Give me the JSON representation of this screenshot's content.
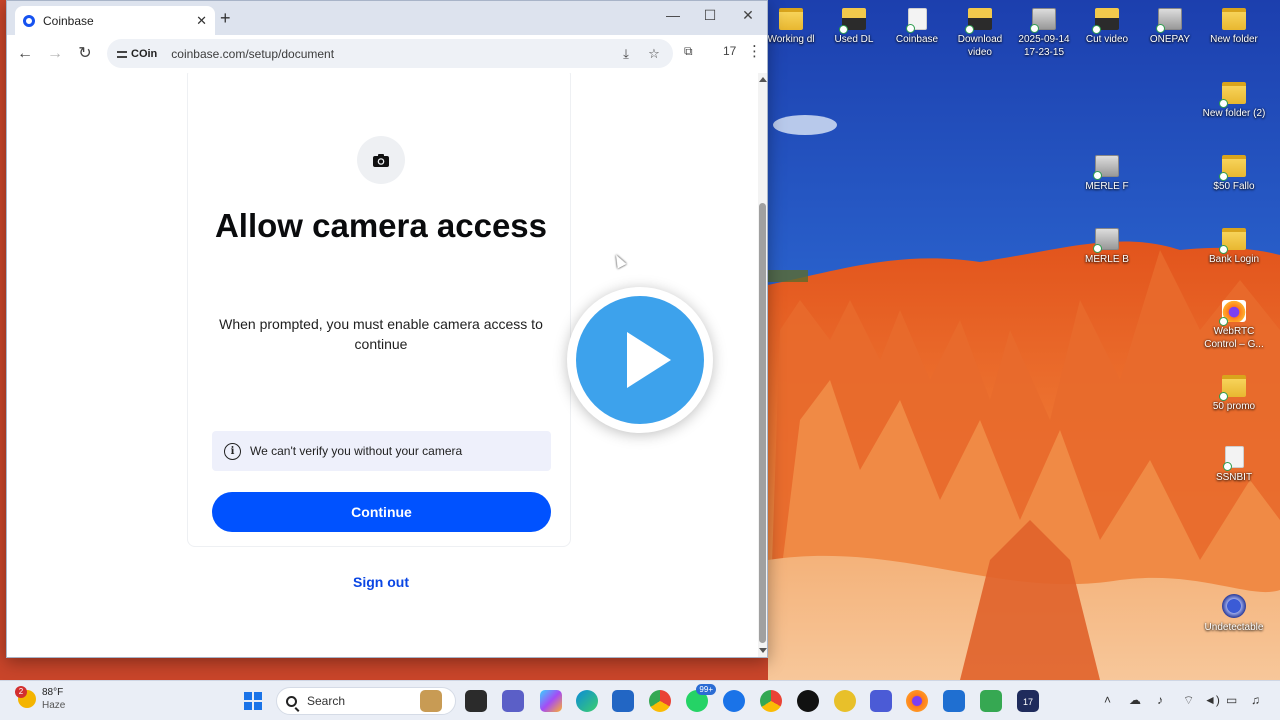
{
  "browser": {
    "tab_title": "Coinbase",
    "tab_close": "✕",
    "new_tab": "+",
    "window_controls": {
      "minimize": "—",
      "maximize": "☐",
      "close": "✕"
    },
    "nav": {
      "back": "←",
      "forward": "→",
      "reload": "↻"
    },
    "site_chip": "COin",
    "url": "coinbase.com/setup/document",
    "tab_count": "17",
    "menu": "⋮"
  },
  "page": {
    "heading": "Allow camera access",
    "subtext": "When prompted, you must enable camera access to continue",
    "notice": "We can't verify you without your camera",
    "continue_label": "Continue",
    "signout_label": "Sign out",
    "accent_color": "#0052ff"
  },
  "desktop_icons": [
    {
      "label": "Working dl",
      "type": "folder"
    },
    {
      "label": "Used DL",
      "type": "video"
    },
    {
      "label": "Coinbase",
      "type": "file"
    },
    {
      "label": "Download video",
      "type": "video"
    },
    {
      "label": "2025-09-14 17-23-15",
      "type": "screenshot"
    },
    {
      "label": "Cut video",
      "type": "video"
    },
    {
      "label": "ONEPAY",
      "type": "screenshot"
    },
    {
      "label": "New folder",
      "type": "folder"
    },
    {
      "label": "New folder (2)",
      "type": "folder"
    },
    {
      "label": "MERLE F",
      "type": "screenshot"
    },
    {
      "label": "$50 Fallo",
      "type": "folder"
    },
    {
      "label": "MERLE B",
      "type": "screenshot"
    },
    {
      "label": "Bank Login",
      "type": "folder"
    },
    {
      "label": "WebRTC Control – G...",
      "type": "firefox"
    },
    {
      "label": "50 promo",
      "type": "folder"
    },
    {
      "label": "SSNBIT",
      "type": "file"
    },
    {
      "label": "Undetectable",
      "type": "app"
    }
  ],
  "taskbar": {
    "weather_temp": "88°F",
    "weather_cond": "Haze",
    "weather_badge": "2",
    "search_placeholder": "Search",
    "teams_badge": "99+",
    "calendar_day": "17"
  }
}
